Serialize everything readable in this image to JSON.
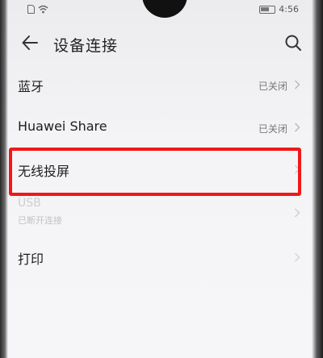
{
  "status": {
    "time": "4:56",
    "icons": [
      "sim-icon",
      "wifi-icon",
      "battery-icon"
    ]
  },
  "toolbar": {
    "title": "设备连接",
    "back_icon": "back-arrow-icon",
    "search_icon": "search-icon"
  },
  "rows": [
    {
      "label": "蓝牙",
      "value": "已关闭"
    },
    {
      "label": "Huawei Share",
      "value": "已关闭"
    },
    {
      "label": "无线投屏",
      "value": ""
    },
    {
      "label": "USB",
      "sub": "已断开连接"
    },
    {
      "label": "打印"
    }
  ],
  "colors": {
    "highlight": "#f01818",
    "background": "#f4f4f6"
  }
}
